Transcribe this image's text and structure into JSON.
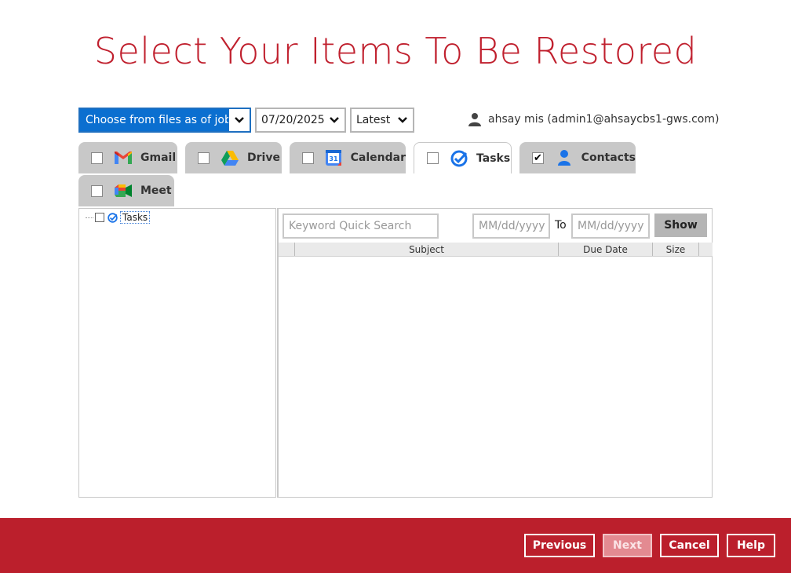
{
  "page_title": "Select Your Items To Be Restored",
  "controls": {
    "mode_select": "Choose from files as of job",
    "date_select": "07/20/2025",
    "version_select": "Latest"
  },
  "user": {
    "label": "ahsay mis (admin1@ahsaycbs1-gws.com)"
  },
  "tabs": [
    {
      "label": "Gmail",
      "checked": false,
      "active": false,
      "icon": "gmail-icon"
    },
    {
      "label": "Drive",
      "checked": false,
      "active": false,
      "icon": "drive-icon"
    },
    {
      "label": "Calendar",
      "checked": false,
      "active": false,
      "icon": "calendar-icon"
    },
    {
      "label": "Tasks",
      "checked": false,
      "active": true,
      "icon": "tasks-icon"
    },
    {
      "label": "Contacts",
      "checked": true,
      "active": false,
      "icon": "contacts-icon"
    },
    {
      "label": "Meet",
      "checked": false,
      "active": false,
      "icon": "meet-icon"
    }
  ],
  "calendar_icon_text": "31",
  "tree": {
    "root_label": "Tasks"
  },
  "filter": {
    "search_placeholder": "Keyword Quick Search",
    "from_placeholder": "MM/dd/yyyy",
    "to_label": "To",
    "to_placeholder": "MM/dd/yyyy",
    "show_label": "Show"
  },
  "table": {
    "columns": [
      "Subject",
      "Due Date",
      "Size"
    ]
  },
  "footer": {
    "previous": "Previous",
    "next": "Next",
    "cancel": "Cancel",
    "help": "Help"
  },
  "colors": {
    "brand_red": "#bb1f2c",
    "title_red": "#c0202e",
    "select_blue": "#0b6fd0"
  }
}
